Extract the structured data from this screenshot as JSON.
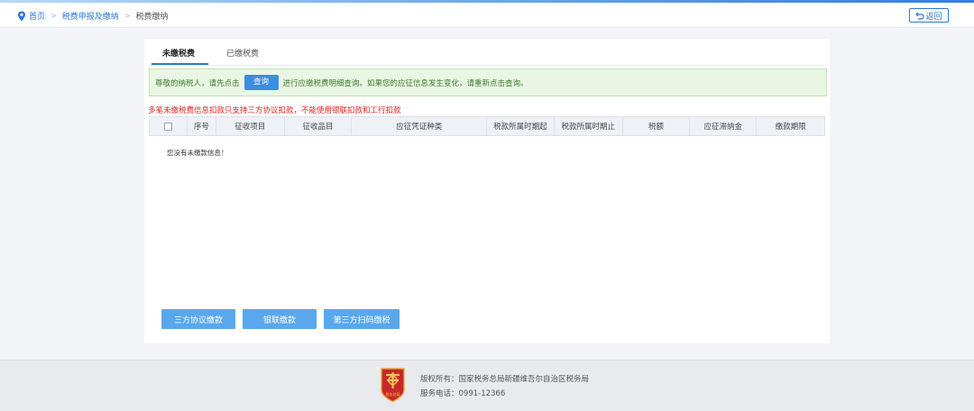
{
  "breadcrumb": {
    "home": "首页",
    "level2": "税费申报及缴纳",
    "current": "税费缴纳",
    "separator": ">"
  },
  "header": {
    "back_label": "返回"
  },
  "tabs": [
    {
      "label": "未缴税费",
      "active": true
    },
    {
      "label": "已缴税费",
      "active": false
    }
  ],
  "notice": {
    "prefix": "尊敬的纳税人，请先点击",
    "query_button": "查询",
    "suffix": "进行应缴税费明细查询。如果您的应征信息发生变化，请重新点击查询。"
  },
  "warning": "多笔未缴税费信息扣款只支持三方协议扣款，不能使用银联扣款和工行扣款",
  "table": {
    "columns": [
      "序号",
      "征收项目",
      "征收品目",
      "应征凭证种类",
      "税款所属时期起",
      "税款所属时期止",
      "税额",
      "应征滞纳金",
      "缴款期限"
    ],
    "rows": [],
    "empty_message": "您没有未缴款信息！"
  },
  "actions": [
    {
      "label": "三方协议缴款"
    },
    {
      "label": "银联缴款"
    },
    {
      "label": "第三方扫码缴税"
    }
  ],
  "footer": {
    "copyright": "版权所有：国家税务总局新疆维吾尔自治区税务局",
    "phone": "服务电话：0991-12366",
    "emblem_text": "税务总局"
  },
  "colors": {
    "accent": "#2a78d4",
    "action_button": "#5aa7ec",
    "notice_bg": "#e9f6e4",
    "warning": "#e02020"
  },
  "icons": {
    "location": "location-pin-icon",
    "back": "return-arrow-icon",
    "emblem": "tax-emblem"
  }
}
